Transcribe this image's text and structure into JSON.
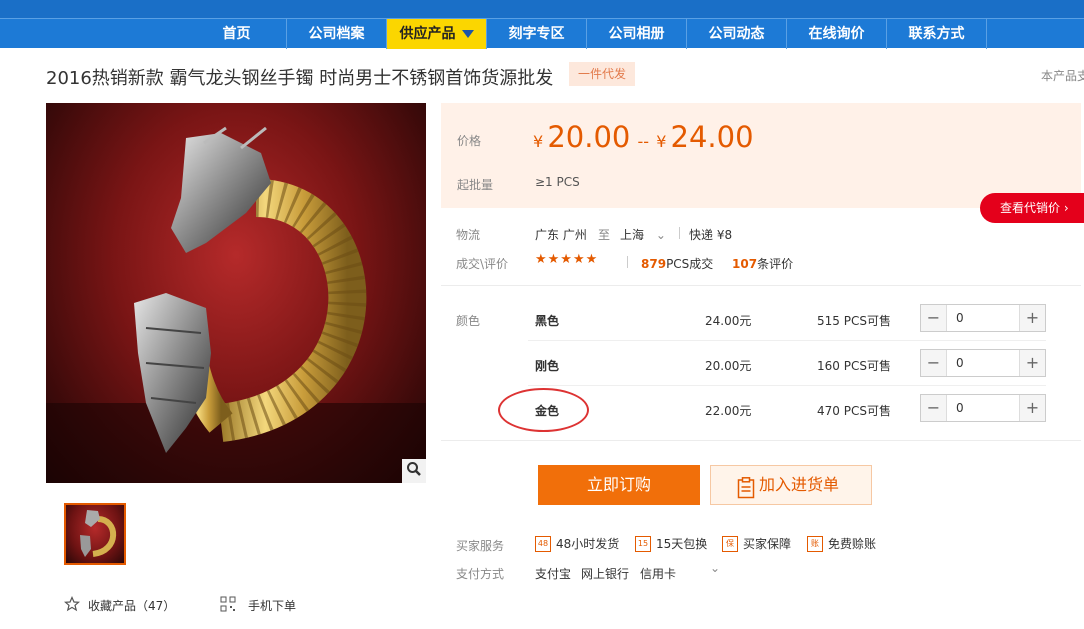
{
  "nav": {
    "items": [
      "首页",
      "公司档案",
      "供应产品",
      "刻字专区",
      "公司相册",
      "公司动态",
      "在线询价",
      "联系方式"
    ],
    "active_index": 2
  },
  "product": {
    "title": "2016热销新款 霸气龙头钢丝手镯 时尚男士不锈钢首饰货源批发",
    "tag": "一件代发",
    "right_note": "本产品支"
  },
  "price": {
    "label": "价格",
    "currency": "¥",
    "low": "20.00",
    "separator": "--",
    "high": "24.00",
    "moq_label": "起批量",
    "moq_value": "≥1  PCS",
    "agent_price_button": "查看代销价"
  },
  "logistics": {
    "label": "物流",
    "from": "广东 广州",
    "to_word": "至",
    "to": "上海",
    "shipping": "快递 ¥8"
  },
  "reviews": {
    "label": "成交\\评价",
    "stars": 5,
    "deals_count": "879",
    "deals_suffix": "PCS成交",
    "review_count": "107",
    "review_suffix": "条评价"
  },
  "variants": {
    "label": "颜色",
    "rows": [
      {
        "name": "黑色",
        "price": "24.00元",
        "stock": "515 PCS可售",
        "qty": "0"
      },
      {
        "name": "刚色",
        "price": "20.00元",
        "stock": "160 PCS可售",
        "qty": "0"
      },
      {
        "name": "金色",
        "price": "22.00元",
        "stock": "470 PCS可售",
        "qty": "0"
      }
    ]
  },
  "actions": {
    "buy_now": "立即订购",
    "add_to_cart": "加入进货单"
  },
  "services": {
    "label": "买家服务",
    "items": [
      {
        "icon": "48",
        "text": "48小时发货"
      },
      {
        "icon": "15",
        "text": "15天包换"
      },
      {
        "icon": "保",
        "text": "买家保障"
      },
      {
        "icon": "账",
        "text": "免费赊账"
      }
    ]
  },
  "payment": {
    "label": "支付方式",
    "methods": [
      "支付宝",
      "网上银行",
      "信用卡"
    ]
  },
  "gallery": {
    "favorite": "收藏产品（47）",
    "mobile_order": "手机下单"
  },
  "colors": {
    "brand_blue": "#1d7ad6",
    "active_yellow": "#fbd600",
    "accent_orange": "#e45a00",
    "buy_orange": "#f16f0a",
    "agent_red": "#e4001b"
  }
}
